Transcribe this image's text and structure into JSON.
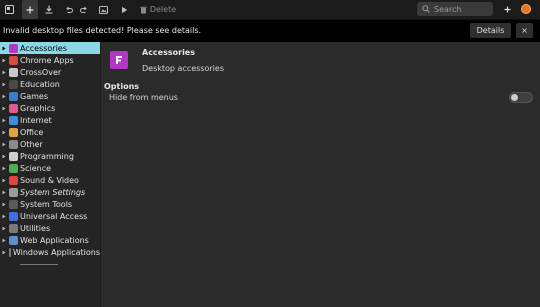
{
  "toolbar": {
    "delete_label": "Delete",
    "search_placeholder": "Search"
  },
  "infobar": {
    "message": "Invalid desktop files detected! Please see details.",
    "details_label": "Details",
    "close_label": "×"
  },
  "sidebar": {
    "items": [
      {
        "label": "Accessories",
        "icon": "accessories-icon",
        "color": "#b137c4",
        "selected": true
      },
      {
        "label": "Chrome Apps",
        "icon": "chrome-icon",
        "color": "#d44c3a"
      },
      {
        "label": "CrossOver",
        "icon": "crossover-icon",
        "color": "#c9c9c9"
      },
      {
        "label": "Education",
        "icon": "education-icon",
        "color": "#4a4a4a"
      },
      {
        "label": "Games",
        "icon": "games-icon",
        "color": "#3d7cc9"
      },
      {
        "label": "Graphics",
        "icon": "graphics-icon",
        "color": "#e05c8f"
      },
      {
        "label": "Internet",
        "icon": "internet-icon",
        "color": "#3d8fe0"
      },
      {
        "label": "Office",
        "icon": "office-icon",
        "color": "#e0a23d"
      },
      {
        "label": "Other",
        "icon": "other-icon",
        "color": "#8a8a8a"
      },
      {
        "label": "Programming",
        "icon": "programming-icon",
        "color": "#cfcfcf"
      },
      {
        "label": "Science",
        "icon": "science-icon",
        "color": "#4caf50"
      },
      {
        "label": "Sound & Video",
        "icon": "sound-video-icon",
        "color": "#e0453d"
      },
      {
        "label": "System Settings",
        "icon": "system-settings-icon",
        "color": "#9c9c9c",
        "italic": true
      },
      {
        "label": "System Tools",
        "icon": "system-tools-icon",
        "color": "#5a5a5a"
      },
      {
        "label": "Universal Access",
        "icon": "universal-access-icon",
        "color": "#3d6fe0"
      },
      {
        "label": "Utilities",
        "icon": "utilities-icon",
        "color": "#7a7a7a"
      },
      {
        "label": "Web Applications",
        "icon": "web-applications-icon",
        "color": "#5a8fd0"
      },
      {
        "label": "Windows Applications",
        "icon": "windows-applications-icon",
        "color": "#7a7a7a"
      }
    ]
  },
  "main": {
    "app_name": "Accessories",
    "app_description": "Desktop accessories",
    "options_title": "Options",
    "hide_label": "Hide from menus",
    "hide_from_menus": false
  },
  "colors": {
    "selection": "#8ad7e6",
    "accent": "#b137c4",
    "avatar": "#e0782b"
  }
}
